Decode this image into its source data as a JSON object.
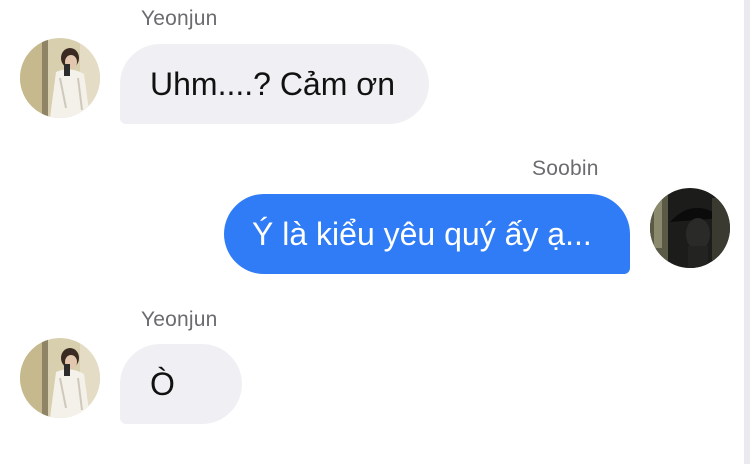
{
  "conversation": {
    "messages": [
      {
        "sender": "Yeonjun",
        "text": "Uhm....? Cảm ơn",
        "direction": "incoming",
        "avatar_icon": "avatar-yeonjun-photo"
      },
      {
        "sender": "Soobin",
        "text": "Ý là kiểu yêu quý ấy ạ...",
        "direction": "outgoing",
        "avatar_icon": "avatar-soobin-photo"
      },
      {
        "sender": "Yeonjun",
        "text": "Ò",
        "direction": "incoming",
        "avatar_icon": "avatar-yeonjun-photo"
      }
    ]
  },
  "colors": {
    "incoming_bubble": "#f0f0f4",
    "outgoing_bubble": "#2f7cf6",
    "sender_name": "#6b6b70"
  }
}
